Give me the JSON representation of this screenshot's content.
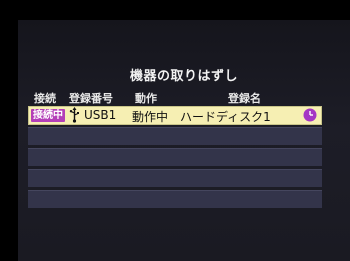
{
  "dialog": {
    "title": "機器の取りはずし"
  },
  "columns": {
    "connection": "接続",
    "reg_number": "登録番号",
    "action": "動作",
    "reg_name": "登録名"
  },
  "rows": [
    {
      "status": "接続中",
      "icon": "usb-icon",
      "reg_number": "USB1",
      "action": "動作中",
      "reg_name": "ハードディスク1",
      "status_icon": "clock-icon",
      "selected": true
    },
    {
      "status": "",
      "reg_number": "",
      "action": "",
      "reg_name": ""
    },
    {
      "status": "",
      "reg_number": "",
      "action": "",
      "reg_name": ""
    },
    {
      "status": "",
      "reg_number": "",
      "action": "",
      "reg_name": ""
    },
    {
      "status": "",
      "reg_number": "",
      "action": "",
      "reg_name": ""
    }
  ],
  "colors": {
    "background": "#1b1b24",
    "selected_row": "#f6efb3",
    "badge": "#b43fb8",
    "clock": "#a536c4",
    "empty_row": "#33344a"
  }
}
